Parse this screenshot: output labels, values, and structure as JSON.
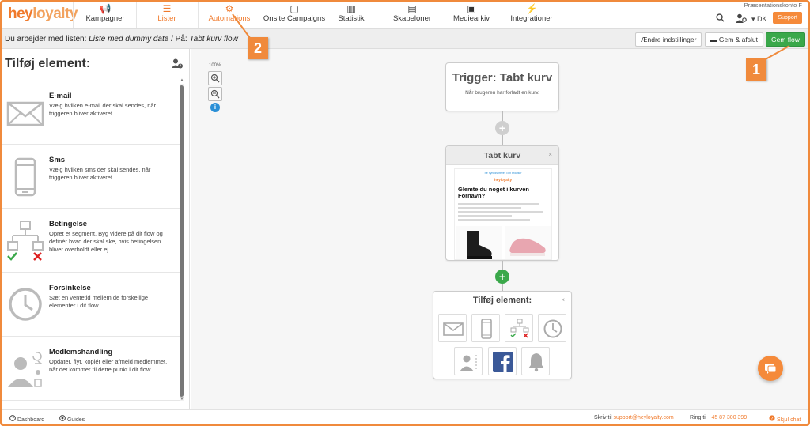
{
  "app": {
    "logo_a": "hey",
    "logo_b": "loyalty",
    "account": "Præsentationskonto F",
    "lang": "DK",
    "support": "Support"
  },
  "nav": [
    {
      "label": "Kampagner",
      "icon": "megaphone-icon",
      "glyph": "📢"
    },
    {
      "label": "Lister",
      "icon": "list-icon",
      "glyph": "☰"
    },
    {
      "label": "Automations",
      "icon": "automation-icon",
      "glyph": "⚙"
    },
    {
      "label": "Onsite Campaigns",
      "icon": "onsite-icon",
      "glyph": "▢"
    },
    {
      "label": "Statistik",
      "icon": "stats-icon",
      "glyph": "▥"
    },
    {
      "label": "Skabeloner",
      "icon": "template-icon",
      "glyph": "▤"
    },
    {
      "label": "Mediearkiv",
      "icon": "media-icon",
      "glyph": "▣"
    },
    {
      "label": "Integrationer",
      "icon": "plug-icon",
      "glyph": "⚡"
    }
  ],
  "listbar": {
    "prefix": "Du arbejder med listen: ",
    "list_name": "Liste med dummy data",
    "suffix": " / På: ",
    "flow_name": "Tabt kurv flow",
    "btn_settings": "Ændre indstillinger",
    "btn_save_exit": "Gem & afslut",
    "btn_save": "Gem flow"
  },
  "callouts": {
    "one": "1",
    "two": "2"
  },
  "sidebar": {
    "title": "Tilføj element:",
    "items": [
      {
        "title": "E-mail",
        "desc": "Vælg hvilken e-mail der skal sendes, når triggeren bliver aktiveret."
      },
      {
        "title": "Sms",
        "desc": "Vælg hvilken sms der skal sendes, når triggeren bliver aktiveret."
      },
      {
        "title": "Betingelse",
        "desc": "Opret et segment. Byg videre på dit flow og definér hvad der skal ske, hvis betingelsen bliver overholdt eller ej."
      },
      {
        "title": "Forsinkelse",
        "desc": "Sæt en ventetid mellem de forskellige elementer i dit flow."
      },
      {
        "title": "Medlemshandling",
        "desc": "Opdater, flyt, kopiér eller afmeld medlemmet, når det kommer til dette punkt i dit flow."
      }
    ]
  },
  "canvas": {
    "zoom": "100%",
    "trigger_title": "Trigger: Tabt kurv",
    "trigger_sub": "Når brugeren har forladt en kurv.",
    "email_node_title": "Tabt kurv",
    "email_preview": {
      "top": "Se nyhedsbrevet i din browser",
      "logo": "heyloyalty",
      "headline": "Glemte du noget i kurven Fornavn?"
    },
    "add_title": "Tilføj element:"
  },
  "footer": {
    "dashboard": "Dashboard",
    "guides": "Guides",
    "write_label": "Skriv til",
    "email": "support@heyloyalty.com",
    "call_label": "Ring til",
    "phone": "+45 87 300 399",
    "hide_chat": "Skjul chat"
  },
  "colors": {
    "accent": "#f07a2c",
    "green": "#3aa84a",
    "info": "#2a8fd6"
  }
}
